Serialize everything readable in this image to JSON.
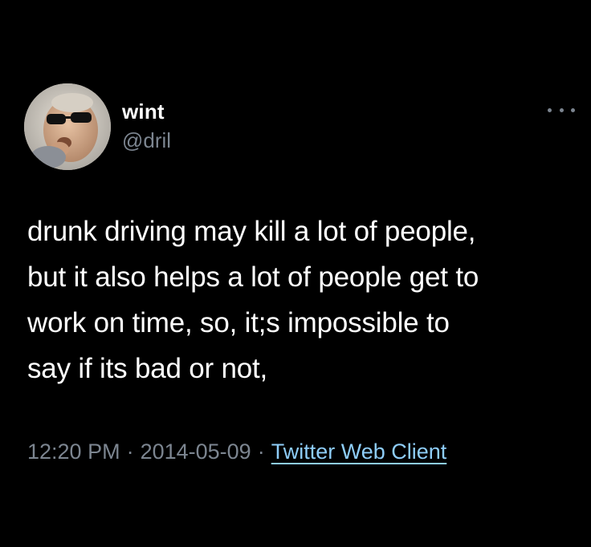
{
  "tweet": {
    "author": {
      "display_name": "wint",
      "handle": "@dril",
      "avatar_icon": "profile-photo-man-in-sunglasses"
    },
    "more_icon": "more-horizontal-icon",
    "text_lines": [
      "drunk driving may kill a lot of people,",
      "but it also helps a lot of people get to",
      "work on time, so, it;s impossible to",
      "say if its bad or not,"
    ],
    "time": "12:20 PM",
    "separator": "·",
    "date": "2014-05-09",
    "client": "Twitter Web Client"
  },
  "colors": {
    "background": "#000000",
    "primary_text": "#ffffff",
    "secondary_text": "#7c8590",
    "link": "#8ecdf8"
  }
}
